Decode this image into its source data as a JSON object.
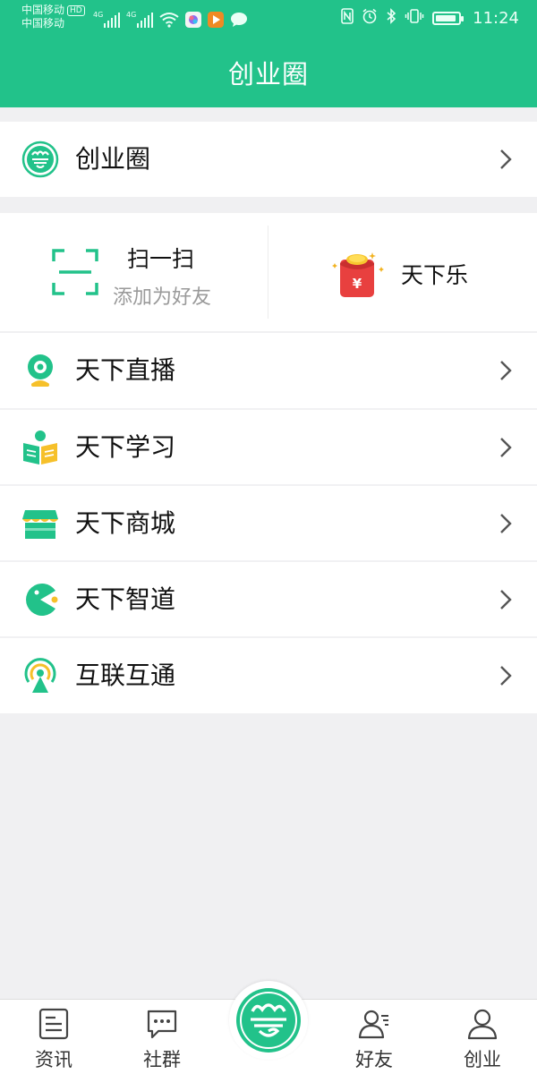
{
  "status_bar": {
    "carrier_1": "中国移动",
    "carrier_hd": "HD",
    "carrier_2": "中国移动",
    "network_1": "4G",
    "network_2": "4G",
    "time": "11:24",
    "battery_level": 0.9,
    "icons": [
      "nfc-icon",
      "alarm-icon",
      "bluetooth-icon",
      "vibrate-icon",
      "battery-icon",
      "wifi-icon",
      "signal-icon"
    ]
  },
  "header": {
    "title": "创业圈"
  },
  "top_row": {
    "label": "创业圈"
  },
  "quick_actions": {
    "scan": {
      "title": "扫一扫",
      "subtitle": "添加为好友"
    },
    "red_packet": {
      "label": "天下乐",
      "symbol": "¥"
    }
  },
  "menu": [
    {
      "label": "天下直播",
      "icon": "live-camera-icon"
    },
    {
      "label": "天下学习",
      "icon": "study-book-icon"
    },
    {
      "label": "天下商城",
      "icon": "store-icon"
    },
    {
      "label": "天下智道",
      "icon": "pacman-icon"
    },
    {
      "label": "互联互通",
      "icon": "broadcast-icon"
    }
  ],
  "bottom_nav": {
    "items": [
      {
        "label": "资讯",
        "icon": "news-icon"
      },
      {
        "label": "社群",
        "icon": "chat-bubble-icon"
      },
      {
        "label": "好友",
        "icon": "friends-icon"
      },
      {
        "label": "创业",
        "icon": "person-icon"
      }
    ],
    "center_icon": "app-logo-icon"
  },
  "colors": {
    "brand": "#22c28a",
    "background": "#f0f0f2",
    "red_packet": "#e8403f",
    "gold": "#f2b21e"
  }
}
